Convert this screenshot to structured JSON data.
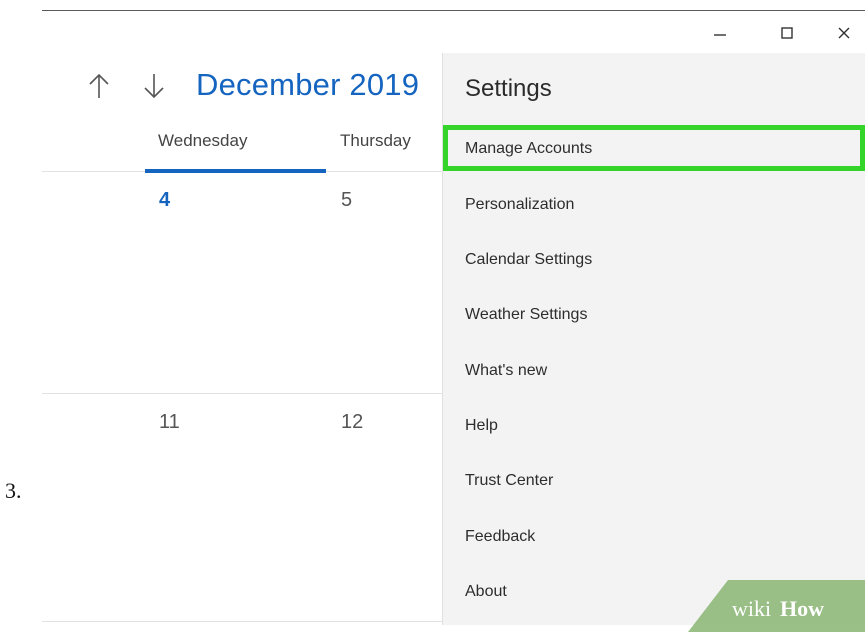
{
  "step": {
    "number": "3."
  },
  "window": {
    "minimize_icon": "minimize-icon",
    "maximize_icon": "maximize-icon",
    "close_icon": "close-icon"
  },
  "calendar": {
    "month_title": "December 2019",
    "nav": {
      "up_icon": "arrow-up-icon",
      "down_icon": "arrow-down-icon"
    },
    "days": [
      "Wednesday",
      "Thursday"
    ],
    "week1": [
      "4",
      "5"
    ],
    "week2": [
      "11",
      "12"
    ],
    "today": "4",
    "accent_color": "#1565c0"
  },
  "settings": {
    "title": "Settings",
    "items": [
      {
        "label": "Manage Accounts",
        "highlighted": true
      },
      {
        "label": "Personalization"
      },
      {
        "label": "Calendar Settings"
      },
      {
        "label": "Weather Settings"
      },
      {
        "label": "What's new"
      },
      {
        "label": "Help"
      },
      {
        "label": "Trust Center"
      },
      {
        "label": "Feedback"
      },
      {
        "label": "About"
      }
    ],
    "highlight_color": "#34d42a"
  },
  "watermark": {
    "wiki": "wiki",
    "how": "How"
  }
}
